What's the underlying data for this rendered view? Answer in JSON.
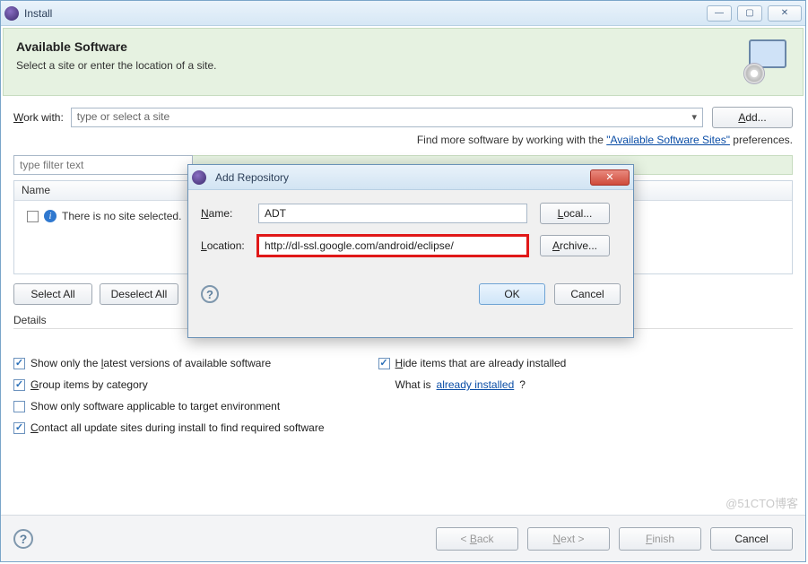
{
  "window": {
    "title": "Install"
  },
  "banner": {
    "title": "Available Software",
    "subtitle": "Select a site or enter the location of a site."
  },
  "workwith": {
    "label_pre": "W",
    "label_post": "ork with:",
    "placeholder": "type or select a site",
    "add_button": "Add..."
  },
  "fine_print": {
    "prefix": "Find more software by working with the ",
    "link": "\"Available Software Sites\"",
    "suffix": " preferences."
  },
  "filter": {
    "placeholder": "type filter text"
  },
  "tree": {
    "header": "Name",
    "empty_text": "There is no site selected."
  },
  "select": {
    "select_all": "Select All",
    "deselect_all": "Deselect All"
  },
  "details_label": "Details",
  "options": {
    "show_latest": "Show only the latest versions of available software",
    "group_by_category": "Group items by category",
    "show_applicable": "Show only software applicable to target environment",
    "contact_update_sites": "Contact all update sites during install to find required software",
    "hide_installed": "Hide items that are already installed",
    "what_is_prefix": "What is ",
    "what_is_link": "already installed",
    "what_is_suffix": "?"
  },
  "footer": {
    "back": "< Back",
    "next": "Next >",
    "finish": "Finish",
    "cancel": "Cancel"
  },
  "modal": {
    "title": "Add Repository",
    "name_label": "Name:",
    "name_value": "ADT",
    "location_label": "Location:",
    "location_value": "http://dl-ssl.google.com/android/eclipse/",
    "local_button": "Local...",
    "archive_button": "Archive...",
    "ok": "OK",
    "cancel": "Cancel"
  },
  "watermark": "@51CTO博客"
}
